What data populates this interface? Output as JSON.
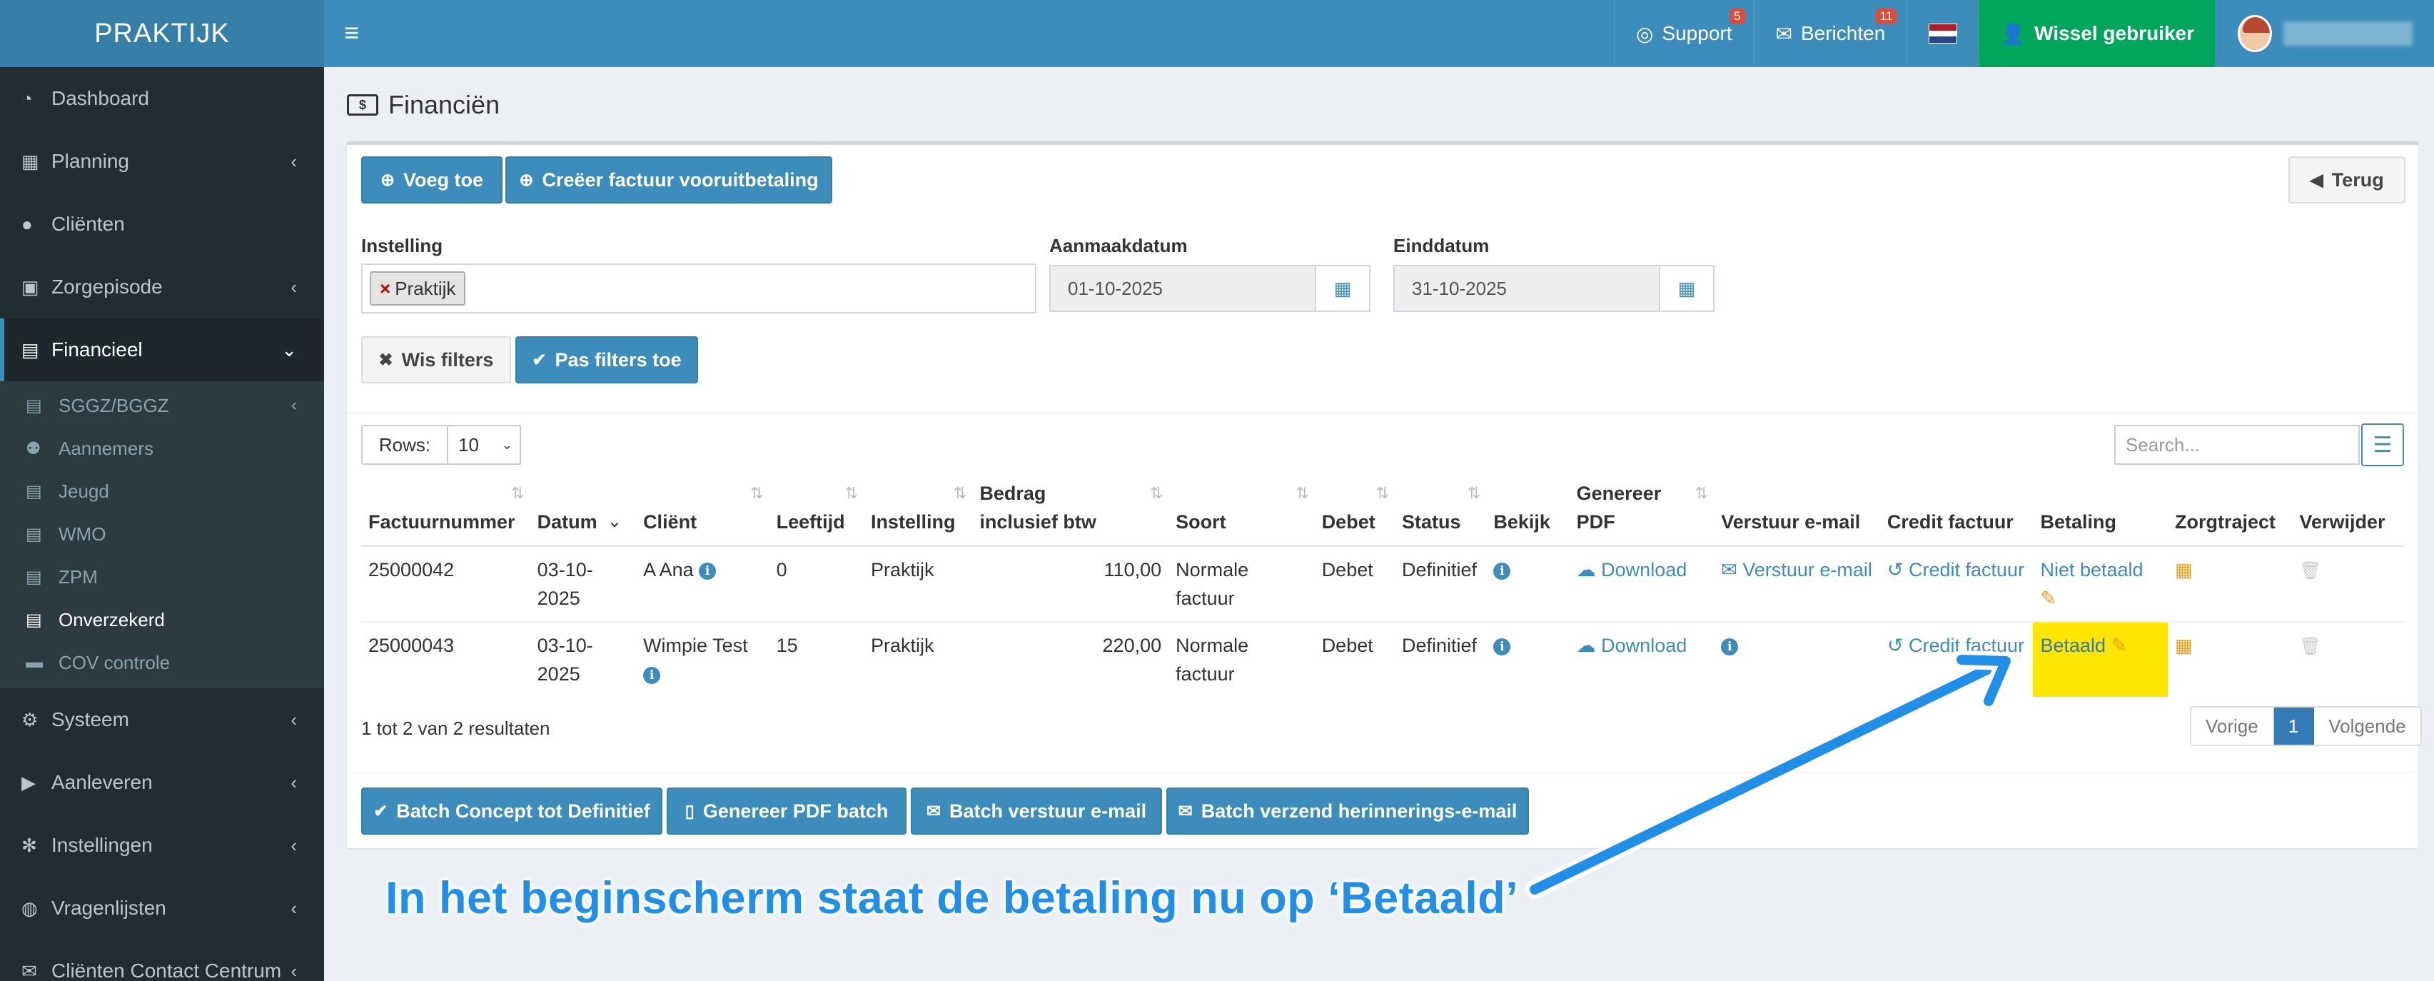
{
  "brand": "PRAKTIJK",
  "topnav": {
    "support_label": "Support",
    "support_badge": "5",
    "berichten_label": "Berichten",
    "berichten_badge": "11",
    "wissel_label": "Wissel gebruiker",
    "flag_colors": [
      "#ae1c28",
      "#ffffff",
      "#21468b"
    ]
  },
  "sidebar": {
    "items": [
      {
        "label": "Dashboard",
        "icon": "dashboard-icon"
      },
      {
        "label": "Planning",
        "icon": "calendar-icon"
      },
      {
        "label": "Cliënten",
        "icon": "user-icon"
      },
      {
        "label": "Zorgepisode",
        "icon": "medkit-icon"
      },
      {
        "label": "Financieel",
        "icon": "book-icon"
      },
      {
        "label": "Systeem",
        "icon": "cogs-icon"
      },
      {
        "label": "Aanleveren",
        "icon": "truck-icon"
      },
      {
        "label": "Instellingen",
        "icon": "gear-icon"
      },
      {
        "label": "Vragenlijsten",
        "icon": "globe-icon"
      },
      {
        "label": "Cliënten Contact Centrum",
        "icon": "envelope-icon"
      }
    ],
    "sub": [
      {
        "label": "SGGZ/BGGZ"
      },
      {
        "label": "Aannemers"
      },
      {
        "label": "Jeugd"
      },
      {
        "label": "WMO"
      },
      {
        "label": "ZPM"
      },
      {
        "label": "Onverzekerd"
      },
      {
        "label": "COV controle"
      }
    ]
  },
  "page": {
    "title": "Financiën",
    "buttons": {
      "voeg_toe": "Voeg toe",
      "creeer": "Creëer factuur vooruitbetaling",
      "terug": "Terug",
      "wis_filters": "Wis filters",
      "pas_filters": "Pas filters toe"
    },
    "filters": {
      "instelling_label": "Instelling",
      "instelling_tag": "Praktijk",
      "aanmaak_label": "Aanmaakdatum",
      "aanmaak_value": "01-10-2025",
      "eind_label": "Einddatum",
      "eind_value": "31-10-2025"
    },
    "rows_label": "Rows:",
    "rows_value": "10",
    "search_placeholder": "Search..."
  },
  "table": {
    "headers": [
      "Factuurnummer",
      "Datum",
      "Cliënt",
      "Leeftijd",
      "Instelling",
      "Bedrag inclusief btw",
      "Soort",
      "Debet",
      "Status",
      "Bekijk",
      "Genereer PDF",
      "Verstuur e-mail",
      "Credit factuur",
      "Betaling",
      "Zorgtraject",
      "Verwijder"
    ],
    "rows": [
      {
        "factuur": "25000042",
        "datum": "03-10-2025",
        "client": "A Ana",
        "leeftijd": "0",
        "instelling": "Praktijk",
        "bedrag": "110,00",
        "soort": "Normale factuur",
        "debet": "Debet",
        "status": "Definitief",
        "pdf": "Download",
        "email": "Verstuur e-mail",
        "credit": "Credit factuur",
        "betaling": "Niet betaald"
      },
      {
        "factuur": "25000043",
        "datum": "03-10-2025",
        "client": "Wimpie Test",
        "leeftijd": "15",
        "instelling": "Praktijk",
        "bedrag": "220,00",
        "soort": "Normale factuur",
        "debet": "Debet",
        "status": "Definitief",
        "pdf": "Download",
        "email": "",
        "credit": "Credit factuur",
        "betaling": "Betaald"
      }
    ]
  },
  "results_text": "1 tot 2 van 2 resultaten",
  "pagination": {
    "prev": "Vorige",
    "current": "1",
    "next": "Volgende"
  },
  "batch": {
    "concept": "Batch Concept tot Definitief",
    "pdf": "Genereer PDF batch",
    "email": "Batch verstuur e-mail",
    "herinnering": "Batch verzend herinnerings-e-mail"
  },
  "annotation": "In het beginscherm staat de betaling nu op ‘Betaald’",
  "colors": {
    "primary": "#3c8dbc",
    "sidebar": "#222d32",
    "success": "#00a65a",
    "highlight": "#ffe600",
    "annotation": "#1f8fe8"
  }
}
